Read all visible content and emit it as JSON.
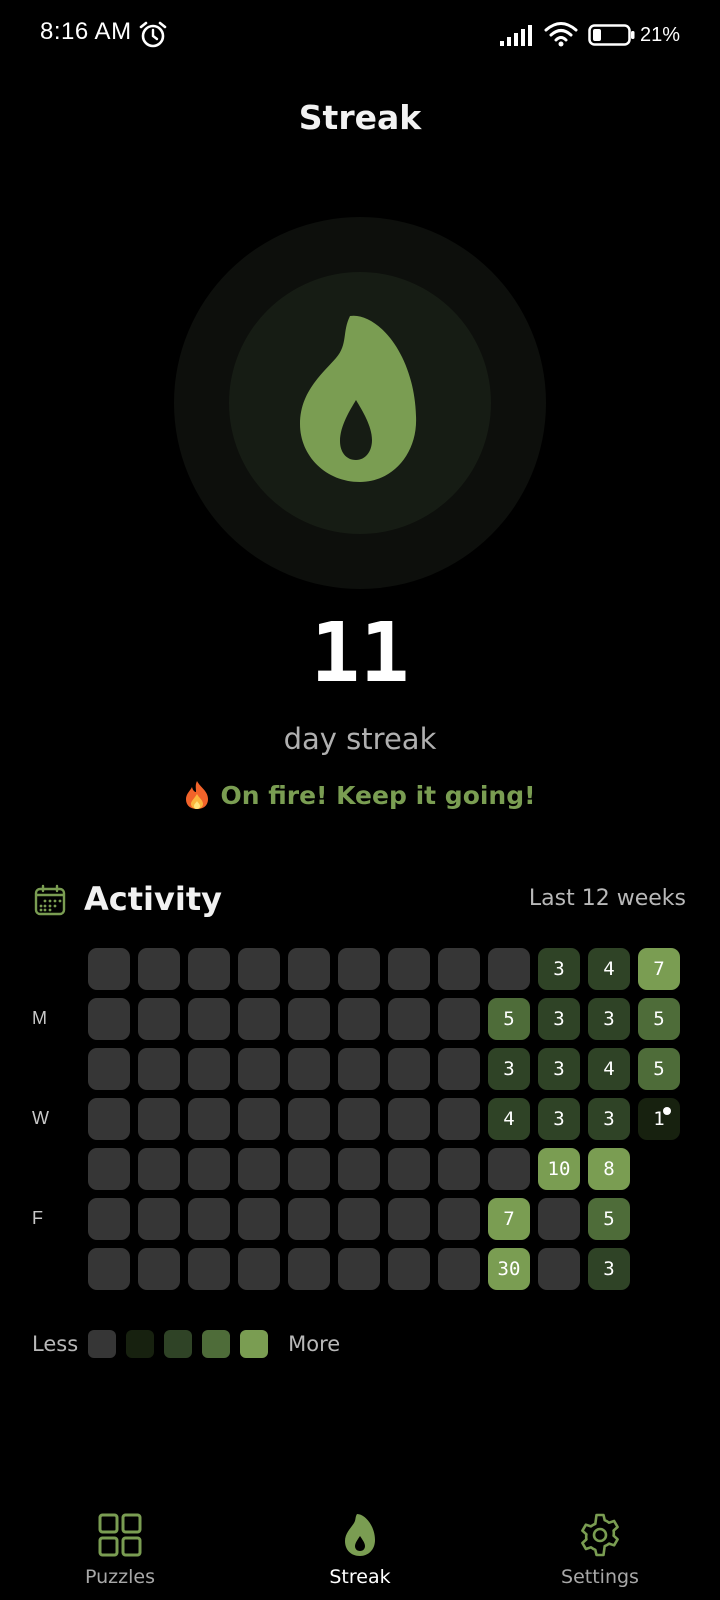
{
  "status_bar": {
    "time": "8:16 AM",
    "battery": "21%",
    "icons": [
      "alarm-icon",
      "signal-icon",
      "wifi-icon",
      "battery-icon"
    ]
  },
  "header": {
    "title": "Streak"
  },
  "hero": {
    "icon": "flame-icon",
    "count": "11",
    "label": "day streak",
    "message": "On fire! Keep it going!",
    "message_icon": "fire-emoji-icon"
  },
  "activity": {
    "icon": "calendar-icon",
    "title": "Activity",
    "range": "Last 12 weeks",
    "day_labels": [
      {
        "label": "M",
        "row": 1
      },
      {
        "label": "W",
        "row": 3
      },
      {
        "label": "F",
        "row": 5
      }
    ],
    "weeks": 12,
    "rows": [
      [
        {
          "lv": 0
        },
        {
          "lv": 0
        },
        {
          "lv": 0
        },
        {
          "lv": 0
        },
        {
          "lv": 0
        },
        {
          "lv": 0
        },
        {
          "lv": 0
        },
        {
          "lv": 0
        },
        {
          "lv": 0
        },
        {
          "lv": 2,
          "v": "3"
        },
        {
          "lv": 2,
          "v": "4"
        },
        {
          "lv": 4,
          "v": "7"
        }
      ],
      [
        {
          "lv": 0
        },
        {
          "lv": 0
        },
        {
          "lv": 0
        },
        {
          "lv": 0
        },
        {
          "lv": 0
        },
        {
          "lv": 0
        },
        {
          "lv": 0
        },
        {
          "lv": 0
        },
        {
          "lv": 3,
          "v": "5"
        },
        {
          "lv": 2,
          "v": "3"
        },
        {
          "lv": 2,
          "v": "3"
        },
        {
          "lv": 3,
          "v": "5"
        }
      ],
      [
        {
          "lv": 0
        },
        {
          "lv": 0
        },
        {
          "lv": 0
        },
        {
          "lv": 0
        },
        {
          "lv": 0
        },
        {
          "lv": 0
        },
        {
          "lv": 0
        },
        {
          "lv": 0
        },
        {
          "lv": 2,
          "v": "3"
        },
        {
          "lv": 2,
          "v": "3"
        },
        {
          "lv": 2,
          "v": "4"
        },
        {
          "lv": 3,
          "v": "5"
        }
      ],
      [
        {
          "lv": 0
        },
        {
          "lv": 0
        },
        {
          "lv": 0
        },
        {
          "lv": 0
        },
        {
          "lv": 0
        },
        {
          "lv": 0
        },
        {
          "lv": 0
        },
        {
          "lv": 0
        },
        {
          "lv": 2,
          "v": "4"
        },
        {
          "lv": 2,
          "v": "3"
        },
        {
          "lv": 2,
          "v": "3"
        },
        {
          "lv": 1,
          "v": "1",
          "today": true
        }
      ],
      [
        {
          "lv": 0
        },
        {
          "lv": 0
        },
        {
          "lv": 0
        },
        {
          "lv": 0
        },
        {
          "lv": 0
        },
        {
          "lv": 0
        },
        {
          "lv": 0
        },
        {
          "lv": 0
        },
        {
          "lv": 0
        },
        {
          "lv": 4,
          "v": "10"
        },
        {
          "lv": 4,
          "v": "8"
        },
        {
          "lv": -1
        }
      ],
      [
        {
          "lv": 0
        },
        {
          "lv": 0
        },
        {
          "lv": 0
        },
        {
          "lv": 0
        },
        {
          "lv": 0
        },
        {
          "lv": 0
        },
        {
          "lv": 0
        },
        {
          "lv": 0
        },
        {
          "lv": 4,
          "v": "7"
        },
        {
          "lv": 0
        },
        {
          "lv": 3,
          "v": "5"
        },
        {
          "lv": -1
        }
      ],
      [
        {
          "lv": 0
        },
        {
          "lv": 0
        },
        {
          "lv": 0
        },
        {
          "lv": 0
        },
        {
          "lv": 0
        },
        {
          "lv": 0
        },
        {
          "lv": 0
        },
        {
          "lv": 0
        },
        {
          "lv": 4,
          "v": "30"
        },
        {
          "lv": 0
        },
        {
          "lv": 2,
          "v": "3"
        },
        {
          "lv": -1
        }
      ]
    ],
    "legend": {
      "less_label": "Less",
      "more_label": "More",
      "colors": [
        "#363636",
        "#17210f",
        "#2f4326",
        "#4e6c39",
        "#7a9d52"
      ]
    }
  },
  "colors": {
    "accent": "#7a9d52",
    "background": "#000000"
  },
  "nav": {
    "items": [
      {
        "label": "Puzzles",
        "icon": "grid-icon",
        "active": false
      },
      {
        "label": "Streak",
        "icon": "flame-icon",
        "active": true
      },
      {
        "label": "Settings",
        "icon": "gear-icon",
        "active": false
      }
    ]
  }
}
